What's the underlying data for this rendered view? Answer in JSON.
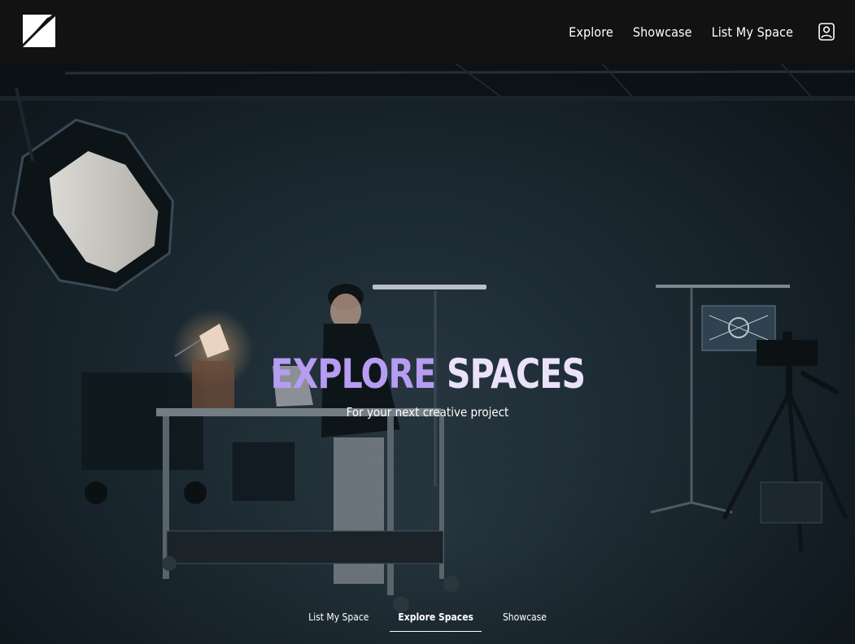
{
  "header": {
    "logo_icon": "brand-logo-icon",
    "nav": [
      {
        "label": "Explore"
      },
      {
        "label": "Showcase"
      },
      {
        "label": "List My Space"
      }
    ],
    "account_icon": "user-account-icon"
  },
  "hero": {
    "title_part_1": "EXPLORE",
    "title_part_2": "SPACES",
    "subtitle": "For your next creative project",
    "title_colors": {
      "first": "#b69cf2",
      "second": "#e9e2fa"
    }
  },
  "tabs": [
    {
      "label": "List My Space",
      "active": false
    },
    {
      "label": "Explore Spaces",
      "active": true
    },
    {
      "label": "Showcase",
      "active": false
    }
  ]
}
